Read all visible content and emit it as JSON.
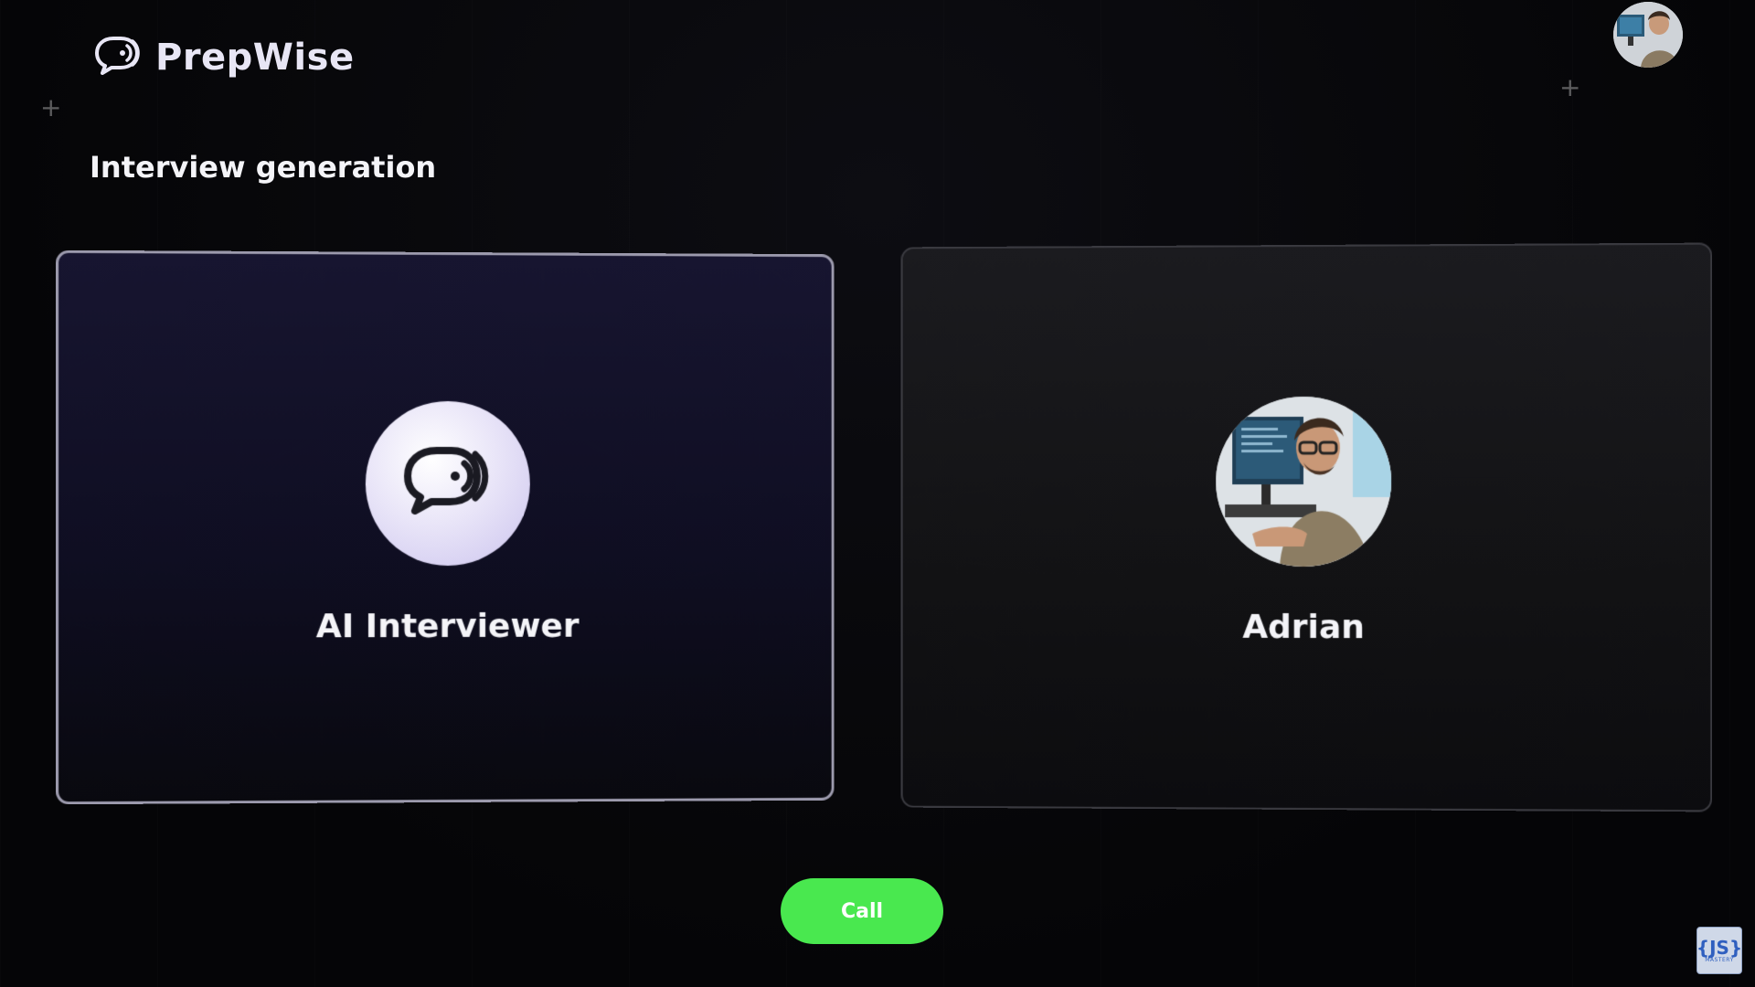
{
  "app": {
    "brand_name": "PrepWise",
    "logo_icon": "chat-bubble-sound-icon"
  },
  "header": {
    "user_avatar_icon": "user-avatar-photo"
  },
  "page": {
    "title": "Interview generation"
  },
  "cards": {
    "ai": {
      "label": "AI Interviewer",
      "icon": "chat-bubble-sound-icon"
    },
    "user": {
      "label": "Adrian",
      "icon": "user-avatar-photo"
    }
  },
  "actions": {
    "call_label": "Call"
  },
  "watermark": {
    "main": "{JS}",
    "sub": "MASTERY"
  },
  "colors": {
    "background": "#050507",
    "ai_card": "#171530",
    "user_card": "#1b1b1f",
    "call_button": "#49e84f",
    "avatar_circle": "#e9e5f8"
  }
}
